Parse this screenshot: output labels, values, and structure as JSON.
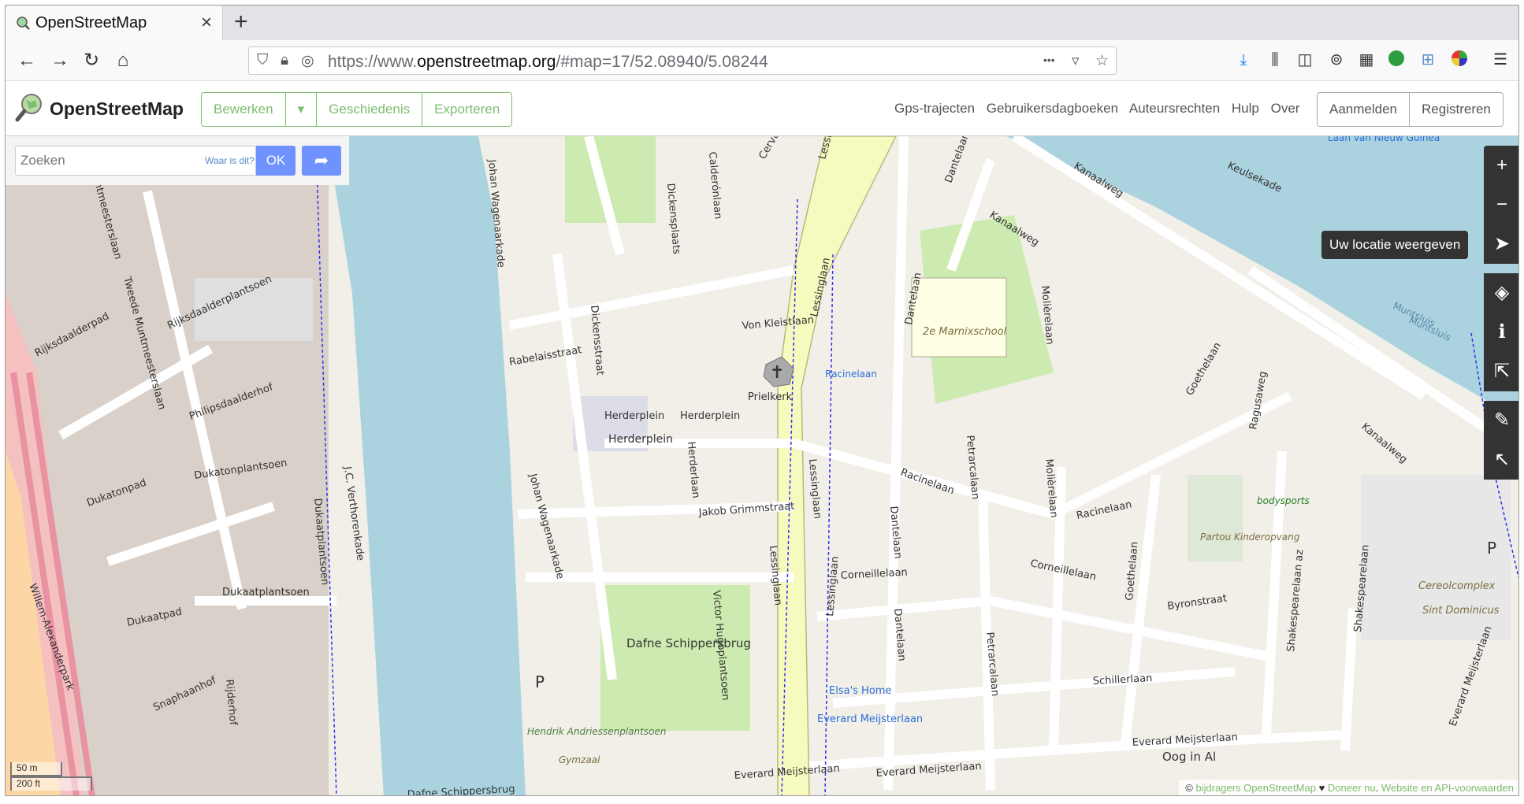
{
  "browser": {
    "tab_title": "OpenStreetMap",
    "close_glyph": "×",
    "new_tab_glyph": "+",
    "url_prefix": "https://www.",
    "url_host": "openstreetmap.org",
    "url_rest": "/#map=17/52.08940/5.08244",
    "url_more": "•••"
  },
  "osm": {
    "brand": "OpenStreetMap",
    "edit_label": "Bewerken",
    "edit_dropdown": "▾",
    "history_label": "Geschiedenis",
    "export_label": "Exporteren",
    "links": [
      "Gps-trajecten",
      "Gebruikersdagboeken",
      "Auteursrechten",
      "Hulp",
      "Over"
    ],
    "login_label": "Aanmelden",
    "register_label": "Registreren"
  },
  "search": {
    "placeholder": "Zoeken",
    "where_link": "Waar is dit?",
    "ok_label": "OK"
  },
  "map_controls": {
    "tooltip": "Uw locatie weergeven",
    "zoom_in": "+",
    "zoom_out": "−"
  },
  "scale": {
    "metric": "50 m",
    "imperial": "200 ft"
  },
  "attribution": {
    "prefix": "© ",
    "contributors": "bijdragers OpenStreetMap",
    "heart": " ♥ ",
    "donate": "Doneer nu",
    "sep": ". ",
    "terms": "Website en API-voorwaarden"
  },
  "map_labels": {
    "streets": [
      "Herderplein",
      "Herderplein",
      "Herderplein",
      "Rabelaisstraat",
      "Von Kleistlaan",
      "Racinelaan",
      "Racinelaan",
      "Racinelaan",
      "Jakob Grimmstraat",
      "Corneillelaan",
      "Corneillelaan",
      "Byronstraat",
      "Schillerlaan",
      "Everard Meijsterlaan",
      "Everard Meijsterlaan",
      "Everard Meijsterlaan",
      "Everard Meijsterlaan",
      "Lessinglaan",
      "Lessinglaan",
      "Lessinglaan",
      "Lessinglaan",
      "Lessinglaan",
      "Dantelaan",
      "Dantelaan",
      "Dantelaan",
      "Dantelaan",
      "Molièrelaan",
      "Molièrelaan",
      "Petrarcalaan",
      "Petrarcalaan",
      "Goethelaan",
      "Goethelaan",
      "Shakespearelaan",
      "Shakespearelaan az",
      "Kanaalweg",
      "Kanaalweg",
      "Kanaalweg",
      "Keulsekade",
      "Johan Wagenaarkade",
      "Johan Wagenaarkade",
      "J.C. Verthorenkade",
      "Tweede Muntmeesterslaan",
      "Muntmeesterslaan",
      "Rijksdaalderpad",
      "Rijksdaalderplantsoen",
      "Philipsdaalderhof",
      "Dukatonplantsoen",
      "Dukatonpad",
      "Dukaatplantsoen",
      "Dukaatplantsoen",
      "Dukaatpad",
      "Snaphaanhof",
      "Rijderhof",
      "Willem-Alexanderpark",
      "Dickensstraat",
      "Dickensplaats",
      "Calderónlaan",
      "Cervantes",
      "Herderlaan",
      "Victor Hugoplantsoen",
      "Ragusaweg",
      "Dafne Schippersbrug",
      "Dafne Schippersbrug",
      "Oog in Al",
      "Muntsluis",
      "Muntsluis"
    ],
    "pois": [
      "Prielkerk",
      "2e Marnixschool",
      "Elsa's Home",
      "Everard Meijsterlaan",
      "Cereolcomplex",
      "Sint Dominicus",
      "bodysports",
      "Partou Kinderopvang",
      "Hendrik Andriessenplantsoen",
      "Gymzaal",
      "Laan van Nieuw Guinea"
    ]
  }
}
